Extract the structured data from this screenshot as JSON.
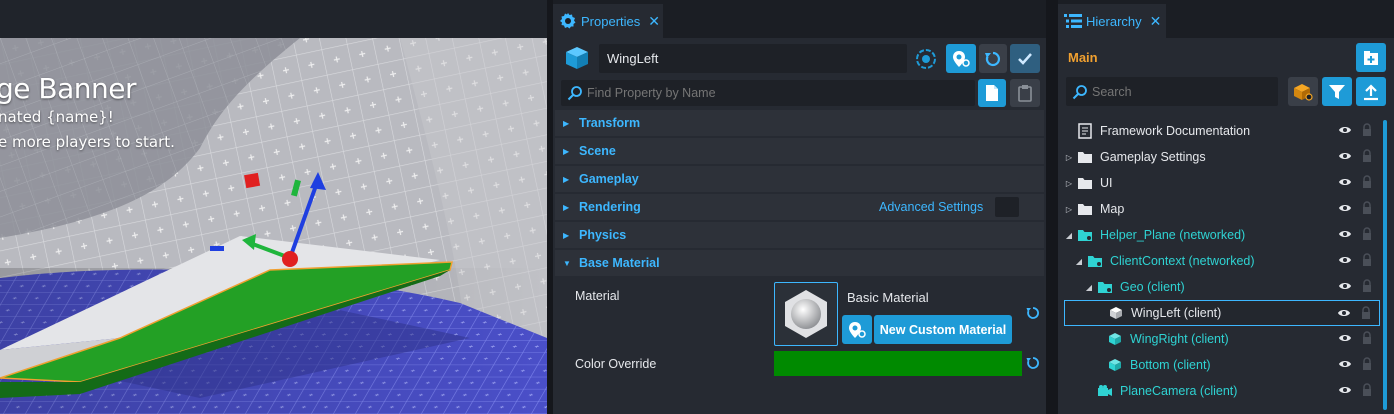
{
  "viewport": {
    "banner_title": "ge Banner",
    "banner_line1": "nated {name}!",
    "banner_line2": "e more players to start."
  },
  "properties": {
    "tab_label": "Properties",
    "object_name": "WingLeft",
    "find_placeholder": "Find Property by Name",
    "sections": {
      "transform": "Transform",
      "scene": "Scene",
      "gameplay": "Gameplay",
      "rendering": "Rendering",
      "physics": "Physics",
      "base_material": "Base Material"
    },
    "advanced_settings": "Advanced Settings",
    "material_label": "Material",
    "material_value": "Basic Material",
    "new_custom_material": "New Custom Material",
    "color_override_label": "Color Override",
    "color_override_value": "#008a00"
  },
  "hierarchy": {
    "tab_label": "Hierarchy",
    "header_title": "Main",
    "search_placeholder": "Search",
    "items": [
      {
        "label": "Framework Documentation",
        "color": "white"
      },
      {
        "label": "Gameplay Settings",
        "color": "white"
      },
      {
        "label": "UI",
        "color": "white"
      },
      {
        "label": "Map",
        "color": "white"
      },
      {
        "label": "Helper_Plane (networked)",
        "color": "cyan"
      },
      {
        "label": "ClientContext (networked)",
        "color": "cyan"
      },
      {
        "label": "Geo (client)",
        "color": "cyan"
      },
      {
        "label": "WingLeft (client)",
        "color": "white"
      },
      {
        "label": "WingRight (client)",
        "color": "cyan"
      },
      {
        "label": "Bottom (client)",
        "color": "cyan"
      },
      {
        "label": "PlaneCamera (client)",
        "color": "cyan"
      }
    ]
  },
  "colors": {
    "accent": "#1e9bd7",
    "link": "#3db7ff",
    "networked": "#2fd3d3",
    "main_title": "#f0a030"
  }
}
